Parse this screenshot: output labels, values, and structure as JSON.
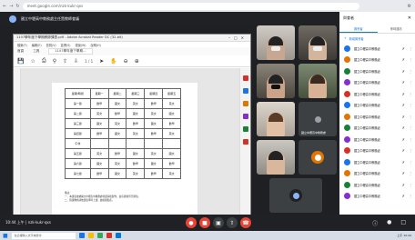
{
  "browser": {
    "url": "meet.google.com/nzk-kukr-qxs"
  },
  "meet": {
    "title": "國立中壢高中教務處主任暨教師會議",
    "code": "10:44 上午 | nzk-kukr-qxs"
  },
  "presentation": {
    "window_title": "1107學年度下學期教師課表.pdf - Adobe Acrobat Reader DC (32-bit)",
    "menu": [
      "檔案(F)",
      "編輯(E)",
      "檢視(V)",
      "簽署(S)",
      "視窗(W)",
      "說明(H)"
    ],
    "tabs": [
      "首頁",
      "工具",
      "1107學年度下學期..."
    ],
    "page_indicator": "1 / 1",
    "table": {
      "header": [
        "星期/時間",
        "星期一",
        "星期二",
        "星期三",
        "星期四",
        "星期五"
      ],
      "rows": [
        [
          "第一節",
          "數學",
          "國文",
          "英文",
          "數學",
          "英文"
        ],
        [
          "第二節",
          "英文",
          "數學",
          "國文",
          "英文",
          "國文"
        ],
        [
          "第三節",
          "國文",
          "英文",
          "數學",
          "國文",
          "數學"
        ],
        [
          "第四節",
          "數學",
          "國文",
          "英文",
          "數學",
          "英文"
        ],
        [
          "午休",
          "",
          "",
          "",
          "",
          ""
        ],
        [
          "第五節",
          "英文",
          "數學",
          "國文",
          "英文",
          "國文"
        ],
        [
          "第六節",
          "國文",
          "英文",
          "數學",
          "國文",
          "數學"
        ],
        [
          "第七節",
          "數學",
          "國文",
          "英文",
          "數學",
          "英文"
        ]
      ]
    },
    "notes": [
      "備註：",
      "一、本課表依據國立中壢高中教務處排課系統製作，如有異動另行通知。",
      "二、授課教師請依課表準時上課，並確實點名。"
    ]
  },
  "tiles": [
    {
      "label": ""
    },
    {
      "label": ""
    },
    {
      "label": ""
    },
    {
      "label": ""
    },
    {
      "label": ""
    },
    {
      "label": "國立中壢高中教務處"
    },
    {
      "label": ""
    },
    {
      "label": ""
    },
    {
      "label": ""
    },
    {
      "label": ""
    }
  ],
  "panel": {
    "title": "與會者",
    "tabs": [
      "與會者",
      "即時通訊"
    ],
    "add_people": "新增與會者",
    "participants": [
      {
        "name": "國立中壢高中教務處",
        "color": "#1a73e8"
      },
      {
        "name": "國立中壢高中教務處",
        "color": "#e37400"
      },
      {
        "name": "國立中壢高中教務處",
        "color": "#188038"
      },
      {
        "name": "國立中壢高中教務處",
        "color": "#8430ce"
      },
      {
        "name": "國立中壢高中教務處",
        "color": "#d93025"
      },
      {
        "name": "國立中壢高中教務處",
        "color": "#1a73e8"
      },
      {
        "name": "國立中壢高中教務處",
        "color": "#e37400"
      },
      {
        "name": "國立中壢高中教務處",
        "color": "#188038"
      },
      {
        "name": "國立中壢高中教務處",
        "color": "#8430ce"
      },
      {
        "name": "國立中壢高中教務處",
        "color": "#d93025"
      },
      {
        "name": "國立中壢高中教務處",
        "color": "#1a73e8"
      },
      {
        "name": "國立中壢高中教務處",
        "color": "#e37400"
      },
      {
        "name": "國立中壢高中教務處",
        "color": "#188038"
      },
      {
        "name": "國立中壢高中教務處",
        "color": "#8430ce"
      }
    ]
  },
  "taskbar": {
    "search": "在這裡輸入文字來搜尋",
    "tray": "上午 10:44"
  }
}
